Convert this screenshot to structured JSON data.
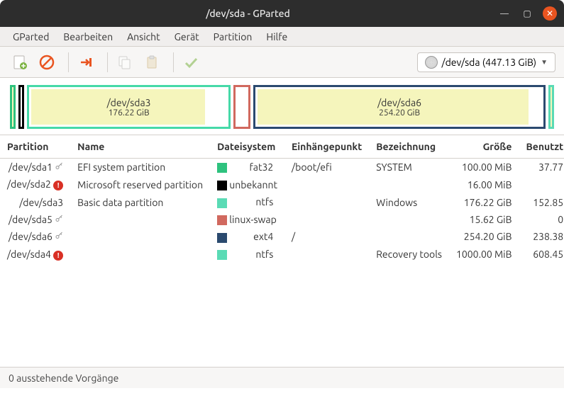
{
  "window": {
    "title": "/dev/sda - GParted"
  },
  "menu": {
    "gparted": "GParted",
    "bearbeiten": "Bearbeiten",
    "ansicht": "Ansicht",
    "geraet": "Gerät",
    "partition": "Partition",
    "hilfe": "Hilfe"
  },
  "device_selector": {
    "label": "/dev/sda  (447.13 GiB)"
  },
  "diagram": {
    "sda3": {
      "label": "/dev/sda3",
      "size": "176.22 GiB"
    },
    "sda6": {
      "label": "/dev/sda6",
      "size": "254.20 GiB"
    }
  },
  "columns": {
    "partition": "Partition",
    "name": "Name",
    "dateisystem": "Dateisystem",
    "mount": "Einhängepunkt",
    "bezeichnung": "Bezeichnung",
    "groesse": "Größe",
    "benutzt": "Benutzt"
  },
  "rows": [
    {
      "partition": "/dev/sda1",
      "icon": "key",
      "name": "EFI system partition",
      "fs_color": "#2ec27e",
      "fs": "fat32",
      "mount": "/boot/efi",
      "label": "SYSTEM",
      "size": "100.00 MiB",
      "used": "37.77"
    },
    {
      "partition": "/dev/sda2",
      "icon": "warn",
      "name": "Microsoft reserved partition",
      "fs_color": "#000000",
      "fs": "unbekannt",
      "mount": "",
      "label": "",
      "size": "16.00 MiB",
      "used": ""
    },
    {
      "partition": "/dev/sda3",
      "icon": "",
      "name": "Basic data partition",
      "fs_color": "#5adbb5",
      "fs": "ntfs",
      "mount": "",
      "label": "Windows",
      "size": "176.22 GiB",
      "used": "152.85"
    },
    {
      "partition": "/dev/sda5",
      "icon": "key",
      "name": "",
      "fs_color": "#d1695f",
      "fs": "linux-swap",
      "mount": "",
      "label": "",
      "size": "15.62 GiB",
      "used": "0"
    },
    {
      "partition": "/dev/sda6",
      "icon": "key",
      "name": "",
      "fs_color": "#2b4a6f",
      "fs": "ext4",
      "mount": "/",
      "label": "",
      "size": "254.20 GiB",
      "used": "238.38"
    },
    {
      "partition": "/dev/sda4",
      "icon": "warn",
      "name": "",
      "fs_color": "#5adbb5",
      "fs": "ntfs",
      "mount": "",
      "label": "Recovery tools",
      "size": "1000.00 MiB",
      "used": "608.45"
    }
  ],
  "status": {
    "text": "0 ausstehende Vorgänge"
  }
}
